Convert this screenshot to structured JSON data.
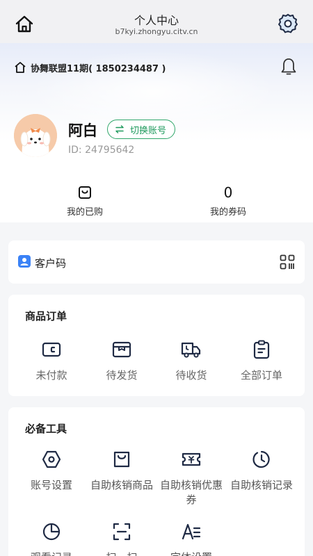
{
  "header": {
    "title": "个人中心",
    "subtitle": "b7kyi.zhongyu.citv.cn",
    "icons": {
      "home": "home-icon",
      "settings": "gear-icon"
    }
  },
  "shop": {
    "name": "协舞联盟11期( 1850234487 )",
    "icon": "shop-icon",
    "notification_icon": "bell-icon"
  },
  "user": {
    "name": "阿白",
    "id_text": "ID: 24795642",
    "switch_label": "切换账号"
  },
  "stats": {
    "purchased": {
      "label": "我的已购",
      "icon": "purchased-icon"
    },
    "coupons": {
      "value": "0",
      "label": "我的券码"
    }
  },
  "customer_code": {
    "label": "客户码",
    "icon": "customer-icon",
    "qr_icon": "qr-code-icon"
  },
  "orders": {
    "title": "商品订单",
    "items": [
      {
        "label": "未付款",
        "icon": "wallet-icon"
      },
      {
        "label": "待发货",
        "icon": "package-icon"
      },
      {
        "label": "待收货",
        "icon": "truck-icon"
      },
      {
        "label": "全部订单",
        "icon": "clipboard-icon"
      }
    ]
  },
  "tools": {
    "title": "必备工具",
    "items": [
      {
        "label": "账号设置",
        "icon": "hexagon-settings-icon"
      },
      {
        "label": "自助核销商品",
        "icon": "bag-icon"
      },
      {
        "label": "自助核销优惠券",
        "icon": "coupon-icon"
      },
      {
        "label": "自助核销记录",
        "icon": "history-icon"
      },
      {
        "label": "观看记录",
        "icon": "pie-chart-icon"
      },
      {
        "label": "扫一扫",
        "icon": "scan-icon"
      },
      {
        "label": "字体设置",
        "icon": "font-icon"
      }
    ]
  },
  "colors": {
    "accent_green": "#1f9a5d",
    "icon_dark": "#1f2a44",
    "customer_icon_blue": "#3b82f6"
  }
}
